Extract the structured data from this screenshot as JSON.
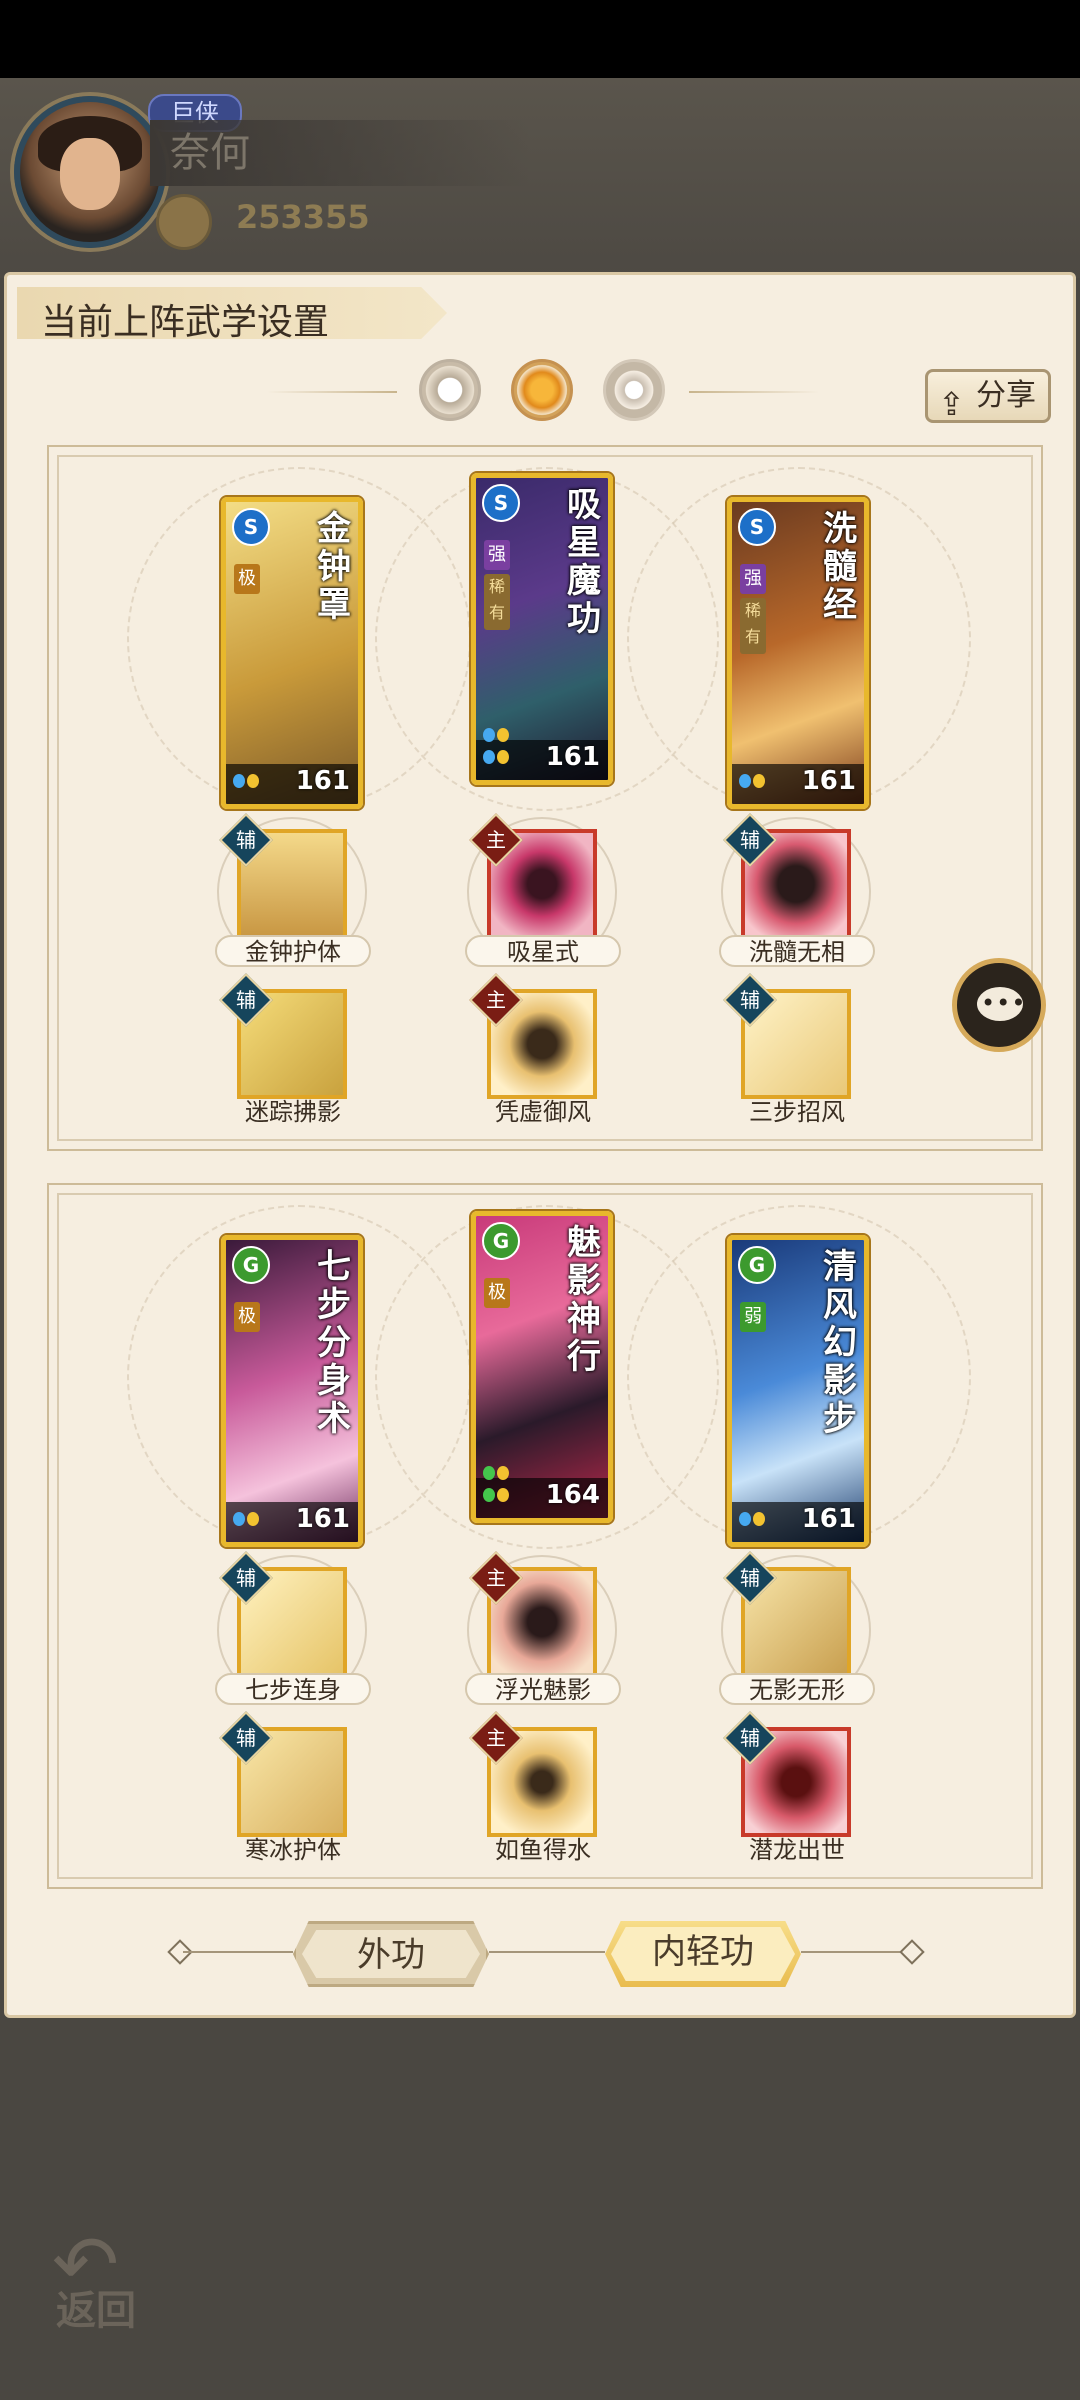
{
  "player": {
    "rank_badge": "巨侠",
    "name": "奈何",
    "power": "253355"
  },
  "panel": {
    "title": "当前上阵武学设置",
    "share_label": "分享",
    "toggles": [
      "moon-toggle",
      "sun-toggle",
      "ring-toggle"
    ]
  },
  "top_set": {
    "cards": [
      {
        "name": "金钟罩",
        "school": "S",
        "grade": "极",
        "tag": "",
        "level": "161"
      },
      {
        "name": "吸星魔功",
        "school": "S",
        "grade": "强",
        "tag": "稀有",
        "level": "161"
      },
      {
        "name": "洗髓经",
        "school": "S",
        "grade": "强",
        "tag": "稀有",
        "level": "161"
      }
    ],
    "skills_row1": [
      {
        "type": "辅",
        "label": "金钟护体"
      },
      {
        "type": "主",
        "label": "吸星式"
      },
      {
        "type": "辅",
        "label": "洗髓无相"
      }
    ],
    "skills_row2": [
      {
        "type": "辅",
        "label": "迷踪拂影"
      },
      {
        "type": "主",
        "label": "凭虚御风"
      },
      {
        "type": "辅",
        "label": "三步招风"
      }
    ]
  },
  "bottom_set": {
    "cards": [
      {
        "name": "七步分身术",
        "school": "G",
        "grade": "极",
        "level": "161"
      },
      {
        "name": "魅影神行",
        "school": "G",
        "grade": "极",
        "level": "164"
      },
      {
        "name": "清风幻影步",
        "school": "G",
        "grade": "弱",
        "level": "161"
      }
    ],
    "skills_row1": [
      {
        "type": "辅",
        "label": "七步连身"
      },
      {
        "type": "主",
        "label": "浮光魅影"
      },
      {
        "type": "辅",
        "label": "无影无形"
      }
    ],
    "skills_row2": [
      {
        "type": "辅",
        "label": "寒冰护体"
      },
      {
        "type": "主",
        "label": "如鱼得水"
      },
      {
        "type": "辅",
        "label": "潜龙出世"
      }
    ]
  },
  "tabs": {
    "outer": "外功",
    "inner": "内轻功",
    "active": "inner"
  },
  "back": {
    "label": "返回"
  },
  "colors": {
    "accent_gold": "#e8b82c",
    "panel_bg": "#f6eee0",
    "aux_badge": "#16455c",
    "main_badge": "#7a1d14"
  }
}
